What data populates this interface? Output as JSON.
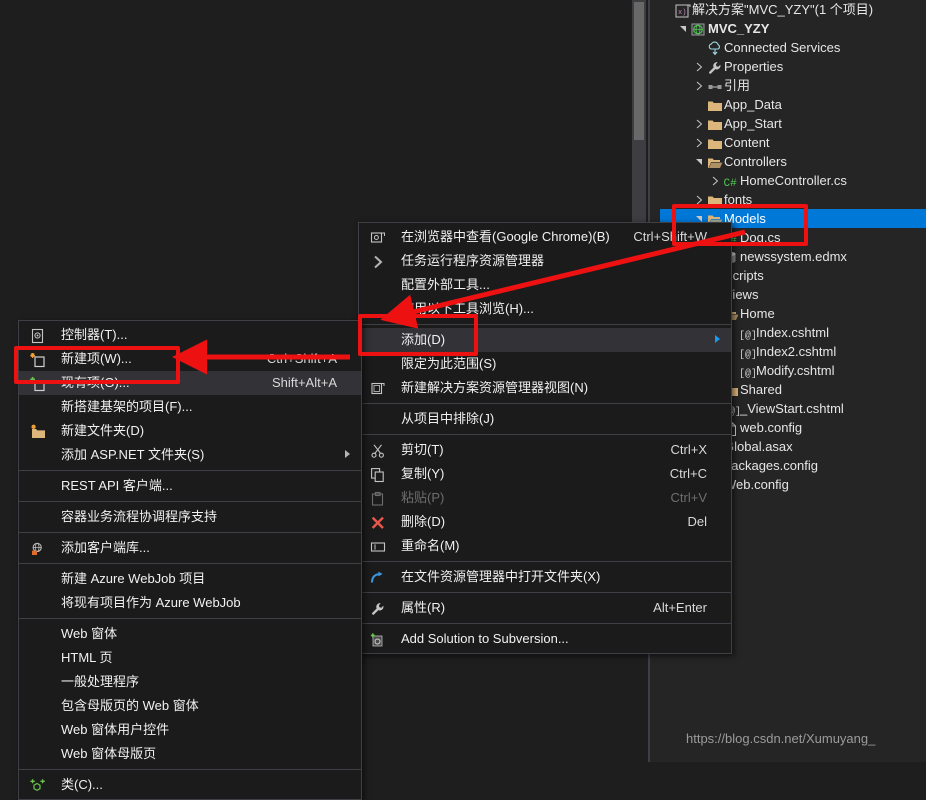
{
  "window": {
    "background_color": "#1e1e1e",
    "accent_selection_color": "#0078d7",
    "annotation_color": "#ee1111"
  },
  "solution_explorer": {
    "name": "Solution Explorer",
    "tree": [
      {
        "label": "解决方案\"MVC_YZY\"(1 个项目)",
        "icon": "solution-icon",
        "indent": 0,
        "twisty": "none",
        "bold": false
      },
      {
        "label": "MVC_YZY",
        "icon": "web-project-icon",
        "indent": 1,
        "twisty": "expanded",
        "bold": true
      },
      {
        "label": "Connected Services",
        "icon": "connected-services-icon",
        "indent": 2,
        "twisty": "none",
        "bold": false
      },
      {
        "label": "Properties",
        "icon": "wrench-icon",
        "indent": 2,
        "twisty": "collapsed",
        "bold": false
      },
      {
        "label": "引用",
        "icon": "references-icon",
        "indent": 2,
        "twisty": "collapsed",
        "bold": false
      },
      {
        "label": "App_Data",
        "icon": "folder-icon",
        "indent": 2,
        "twisty": "none",
        "bold": false
      },
      {
        "label": "App_Start",
        "icon": "folder-icon",
        "indent": 2,
        "twisty": "collapsed",
        "bold": false
      },
      {
        "label": "Content",
        "icon": "folder-icon",
        "indent": 2,
        "twisty": "collapsed",
        "bold": false
      },
      {
        "label": "Controllers",
        "icon": "folder-open-icon",
        "indent": 2,
        "twisty": "expanded",
        "bold": false
      },
      {
        "label": "HomeController.cs",
        "icon": "csharp-file-icon",
        "indent": 3,
        "twisty": "collapsed",
        "bold": false
      },
      {
        "label": "fonts",
        "icon": "folder-icon",
        "indent": 2,
        "twisty": "collapsed",
        "bold": false
      },
      {
        "label": "Models",
        "icon": "folder-open-icon",
        "indent": 2,
        "twisty": "expanded",
        "bold": false,
        "selected": true
      },
      {
        "label": "Dog.cs",
        "icon": "csharp-file-icon",
        "indent": 3,
        "twisty": "none",
        "bold": false
      },
      {
        "label": "newssystem.edmx",
        "icon": "edmx-icon",
        "indent": 3,
        "twisty": "none",
        "bold": false
      },
      {
        "label": "Scripts",
        "icon": "folder-icon",
        "indent": 2,
        "twisty": "collapsed",
        "bold": false
      },
      {
        "label": "Views",
        "icon": "folder-open-icon",
        "indent": 2,
        "twisty": "expanded",
        "bold": false
      },
      {
        "label": "Home",
        "icon": "folder-open-icon",
        "indent": 3,
        "twisty": "expanded",
        "bold": false
      },
      {
        "label": "Index.cshtml",
        "icon": "cshtml-icon",
        "indent": 4,
        "twisty": "none",
        "bold": false
      },
      {
        "label": "Index2.cshtml",
        "icon": "cshtml-icon",
        "indent": 4,
        "twisty": "none",
        "bold": false
      },
      {
        "label": "Modify.cshtml",
        "icon": "cshtml-icon",
        "indent": 4,
        "twisty": "none",
        "bold": false
      },
      {
        "label": "Shared",
        "icon": "folder-icon",
        "indent": 3,
        "twisty": "collapsed",
        "bold": false
      },
      {
        "label": "_ViewStart.cshtml",
        "icon": "cshtml-icon",
        "indent": 3,
        "twisty": "none",
        "bold": false
      },
      {
        "label": "web.config",
        "icon": "config-file-icon",
        "indent": 3,
        "twisty": "none",
        "bold": false
      },
      {
        "label": "Global.asax",
        "icon": "asax-icon",
        "indent": 2,
        "twisty": "collapsed",
        "bold": false
      },
      {
        "label": "packages.config",
        "icon": "config-file-icon",
        "indent": 2,
        "twisty": "none",
        "bold": false
      },
      {
        "label": "Web.config",
        "icon": "config-file-icon",
        "indent": 2,
        "twisty": "collapsed",
        "bold": false
      }
    ]
  },
  "context_menu": {
    "name": "project-context-menu",
    "items": [
      {
        "label": "在浏览器中查看(Google Chrome)(B)",
        "shortcut": "Ctrl+Shift+W",
        "icon": "browser-icon",
        "submenu": false,
        "disabled": false,
        "highlighted": false
      },
      {
        "label": "任务运行程序资源管理器",
        "shortcut": "",
        "icon": "chevron-right-icon",
        "submenu": false,
        "disabled": false,
        "highlighted": false
      },
      {
        "label": "配置外部工具...",
        "shortcut": "",
        "icon": "",
        "submenu": false,
        "disabled": false,
        "highlighted": false
      },
      {
        "label": "使用以下工具浏览(H)...",
        "shortcut": "",
        "icon": "",
        "submenu": false,
        "disabled": false,
        "highlighted": false
      },
      {
        "separator": true
      },
      {
        "label": "添加(D)",
        "shortcut": "",
        "icon": "",
        "submenu": true,
        "disabled": false,
        "highlighted": true
      },
      {
        "label": "限定为此范围(S)",
        "shortcut": "",
        "icon": "",
        "submenu": false,
        "disabled": false,
        "highlighted": false
      },
      {
        "label": "新建解决方案资源管理器视图(N)",
        "shortcut": "",
        "icon": "new-explorer-view-icon",
        "submenu": false,
        "disabled": false,
        "highlighted": false
      },
      {
        "separator": true
      },
      {
        "label": "从项目中排除(J)",
        "shortcut": "",
        "icon": "",
        "submenu": false,
        "disabled": false,
        "highlighted": false
      },
      {
        "separator": true
      },
      {
        "label": "剪切(T)",
        "shortcut": "Ctrl+X",
        "icon": "scissors-icon",
        "submenu": false,
        "disabled": false,
        "highlighted": false
      },
      {
        "label": "复制(Y)",
        "shortcut": "Ctrl+C",
        "icon": "copy-icon",
        "submenu": false,
        "disabled": false,
        "highlighted": false
      },
      {
        "label": "粘贴(P)",
        "shortcut": "Ctrl+V",
        "icon": "paste-icon",
        "submenu": false,
        "disabled": true,
        "highlighted": false
      },
      {
        "label": "删除(D)",
        "shortcut": "Del",
        "icon": "delete-x-icon",
        "submenu": false,
        "disabled": false,
        "highlighted": false
      },
      {
        "label": "重命名(M)",
        "shortcut": "",
        "icon": "rename-icon",
        "submenu": false,
        "disabled": false,
        "highlighted": false
      },
      {
        "separator": true
      },
      {
        "label": "在文件资源管理器中打开文件夹(X)",
        "shortcut": "",
        "icon": "open-folder-arrow-icon",
        "submenu": false,
        "disabled": false,
        "highlighted": false
      },
      {
        "separator": true
      },
      {
        "label": "属性(R)",
        "shortcut": "Alt+Enter",
        "icon": "wrench-icon",
        "submenu": false,
        "disabled": false,
        "highlighted": false
      },
      {
        "separator": true
      },
      {
        "label": "Add Solution to Subversion...",
        "shortcut": "",
        "icon": "subversion-icon",
        "submenu": false,
        "disabled": false,
        "highlighted": false
      }
    ]
  },
  "add_submenu": {
    "name": "add-submenu",
    "items": [
      {
        "label": "控制器(T)...",
        "shortcut": "",
        "icon": "controller-icon",
        "submenu": false,
        "disabled": false,
        "highlighted": false
      },
      {
        "label": "新建项(W)...",
        "shortcut": "Ctrl+Shift+A",
        "icon": "new-item-icon",
        "submenu": false,
        "disabled": false,
        "highlighted": false
      },
      {
        "label": "现有项(G)...",
        "shortcut": "Shift+Alt+A",
        "icon": "existing-item-icon",
        "submenu": false,
        "disabled": false,
        "highlighted": true
      },
      {
        "label": "新搭建基架的项目(F)...",
        "shortcut": "",
        "icon": "",
        "submenu": false,
        "disabled": false,
        "highlighted": false
      },
      {
        "label": "新建文件夹(D)",
        "shortcut": "",
        "icon": "new-folder-icon",
        "submenu": false,
        "disabled": false,
        "highlighted": false
      },
      {
        "label": "添加 ASP.NET 文件夹(S)",
        "shortcut": "",
        "icon": "",
        "submenu": true,
        "disabled": false,
        "highlighted": false
      },
      {
        "separator": true
      },
      {
        "label": "REST API 客户端...",
        "shortcut": "",
        "icon": "",
        "submenu": false,
        "disabled": false,
        "highlighted": false
      },
      {
        "separator": true
      },
      {
        "label": "容器业务流程协调程序支持",
        "shortcut": "",
        "icon": "",
        "submenu": false,
        "disabled": false,
        "highlighted": false
      },
      {
        "separator": true
      },
      {
        "label": "添加客户端库...",
        "shortcut": "",
        "icon": "client-library-icon",
        "submenu": false,
        "disabled": false,
        "highlighted": false
      },
      {
        "separator": true
      },
      {
        "label": "新建 Azure WebJob 项目",
        "shortcut": "",
        "icon": "",
        "submenu": false,
        "disabled": false,
        "highlighted": false
      },
      {
        "label": "将现有项目作为 Azure WebJob",
        "shortcut": "",
        "icon": "",
        "submenu": false,
        "disabled": false,
        "highlighted": false
      },
      {
        "separator": true
      },
      {
        "label": "Web 窗体",
        "shortcut": "",
        "icon": "",
        "submenu": false,
        "disabled": false,
        "highlighted": false
      },
      {
        "label": "HTML 页",
        "shortcut": "",
        "icon": "",
        "submenu": false,
        "disabled": false,
        "highlighted": false
      },
      {
        "label": "一般处理程序",
        "shortcut": "",
        "icon": "",
        "submenu": false,
        "disabled": false,
        "highlighted": false
      },
      {
        "label": "包含母版页的 Web 窗体",
        "shortcut": "",
        "icon": "",
        "submenu": false,
        "disabled": false,
        "highlighted": false
      },
      {
        "label": "Web 窗体用户控件",
        "shortcut": "",
        "icon": "",
        "submenu": false,
        "disabled": false,
        "highlighted": false
      },
      {
        "label": "Web 窗体母版页",
        "shortcut": "",
        "icon": "",
        "submenu": false,
        "disabled": false,
        "highlighted": false
      },
      {
        "separator": true
      },
      {
        "label": "类(C)...",
        "shortcut": "",
        "icon": "class-icon",
        "submenu": false,
        "disabled": false,
        "highlighted": false
      }
    ]
  },
  "annotations": {
    "name": "red-highlight-annotations",
    "boxes": [
      "models-node",
      "add-menu-item",
      "new-item-menu-item"
    ],
    "arrows": [
      "models-to-add-arrow",
      "add-to-new-item-arrow"
    ]
  },
  "watermark": {
    "text": "https://blog.csdn.net/Xumuyang_"
  }
}
